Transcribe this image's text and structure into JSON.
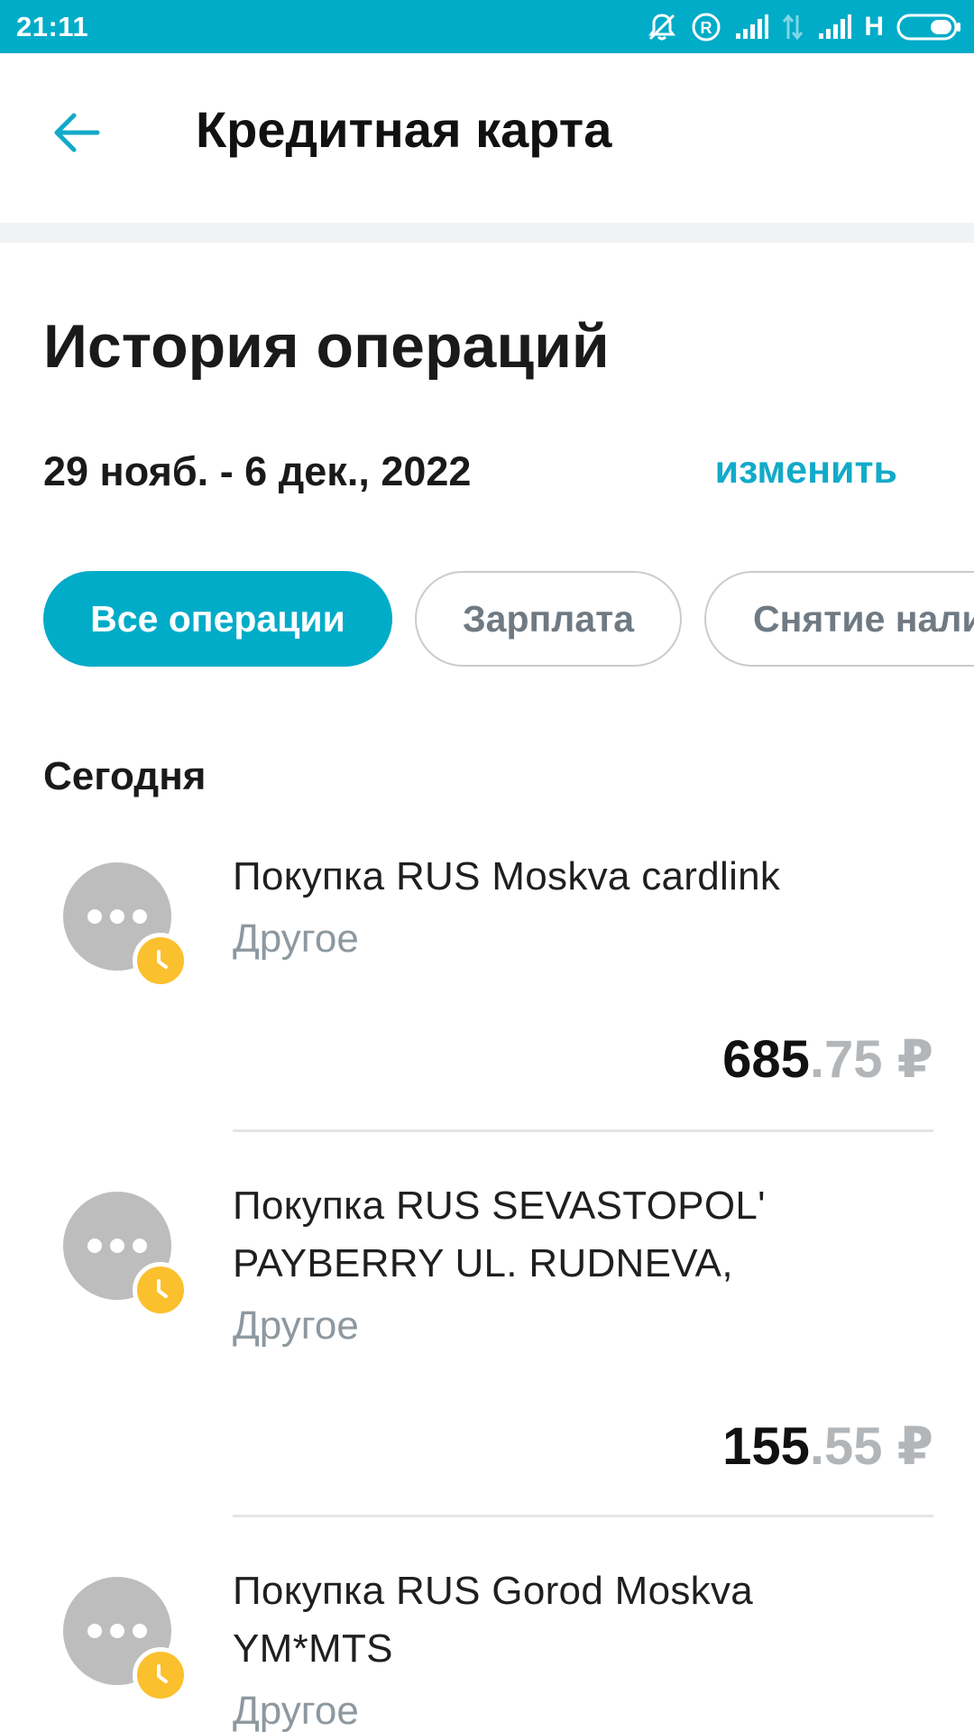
{
  "status_bar": {
    "time": "21:11",
    "network_label": "H",
    "background": "#00acc8"
  },
  "header": {
    "title": "Кредитная карта",
    "back_icon": "arrow-left-icon"
  },
  "main": {
    "title": "История операций",
    "date_range": "29 нояб. - 6 дек., 2022",
    "change_label": "изменить",
    "filters": [
      {
        "label": "Все операции",
        "active": true
      },
      {
        "label": "Зарплата",
        "active": false
      },
      {
        "label": "Снятие нали",
        "active": false
      }
    ],
    "section_label": "Сегодня",
    "transactions": [
      {
        "name_lines": [
          "Покупка RUS Moskva cardlink"
        ],
        "category": "Другое",
        "amount_int": "685",
        "amount_frac": ".75 ₽",
        "icon": "more-dots-icon",
        "status_icon": "clock-icon"
      },
      {
        "name_lines": [
          "Покупка RUS SEVASTOPOL'",
          "PAYBERRY UL. RUDNEVA,"
        ],
        "category": "Другое",
        "amount_int": "155",
        "amount_frac": ".55 ₽",
        "icon": "more-dots-icon",
        "status_icon": "clock-icon"
      },
      {
        "name_lines": [
          "Покупка RUS Gorod Moskva",
          "YM*MTS"
        ],
        "category": "Другое",
        "icon": "more-dots-icon",
        "status_icon": "clock-icon"
      }
    ]
  },
  "colors": {
    "accent": "#00acc8",
    "link": "#12aac9",
    "pending_badge": "#fbc02d",
    "avatar": "#bdbdbd",
    "muted_text": "#8d98a0"
  }
}
